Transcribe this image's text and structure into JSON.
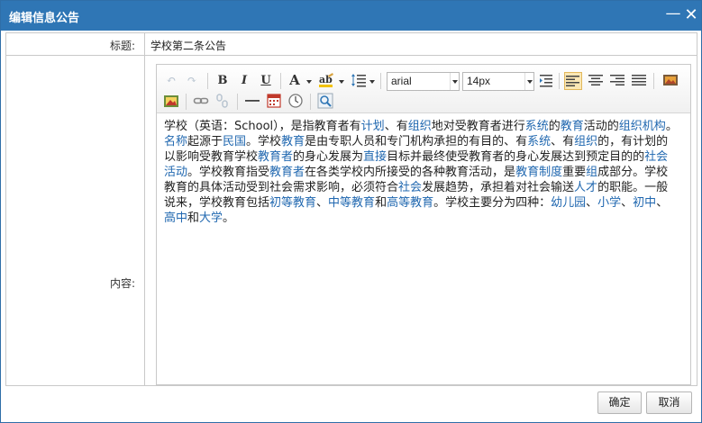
{
  "dialog": {
    "title": "编辑信息公告",
    "minimize_icon": "minimize-icon",
    "close_icon": "close-icon"
  },
  "form": {
    "title_label": "标题:",
    "title_value": "学校第二条公告",
    "content_label": "内容:"
  },
  "editor": {
    "toolbar": {
      "font_family": "arial",
      "font_size": "14px",
      "icons": [
        "undo-icon",
        "redo-icon",
        "bold-icon",
        "italic-icon",
        "underline-icon",
        "font-color-icon",
        "highlight-icon",
        "line-height-icon",
        "font-family-select",
        "font-size-select",
        "indent-icon",
        "align-left-icon",
        "align-center-icon",
        "align-right-icon",
        "justify-icon",
        "image-icon",
        "insert-image-icon",
        "link-icon",
        "unlink-icon",
        "horizontal-rule-icon",
        "date-icon",
        "time-icon",
        "preview-icon"
      ],
      "bold": "B",
      "italic": "I",
      "underline": "U",
      "font_color": "A"
    },
    "content": [
      {
        "t": "学校（英语：School），是指教育者有"
      },
      {
        "t": "计划",
        "link": true
      },
      {
        "t": "、有"
      },
      {
        "t": "组织",
        "link": true
      },
      {
        "t": "地对受教育者进行"
      },
      {
        "t": "系统",
        "link": true
      },
      {
        "t": "的"
      },
      {
        "t": "教育",
        "link": true
      },
      {
        "t": "活动的"
      },
      {
        "t": "组织机构",
        "link": true
      },
      {
        "t": "。"
      },
      {
        "t": "名称",
        "link": true
      },
      {
        "t": "起源于"
      },
      {
        "t": "民国",
        "link": true
      },
      {
        "t": "。学校"
      },
      {
        "t": "教育",
        "link": true
      },
      {
        "t": "是由专职人员和专门机构承担的有目的、有"
      },
      {
        "t": "系统",
        "link": true
      },
      {
        "t": "、有"
      },
      {
        "t": "组织",
        "link": true
      },
      {
        "t": "的，有计划的以影响受教育学校"
      },
      {
        "t": "教育者",
        "link": true
      },
      {
        "t": "的身心发展为"
      },
      {
        "t": "直接",
        "link": true
      },
      {
        "t": "目标并最终使受教育者的身心发展达到预定目的的"
      },
      {
        "t": "社会活动",
        "link": true
      },
      {
        "t": "。学校教育指受"
      },
      {
        "t": "教育者",
        "link": true
      },
      {
        "t": "在各类学校内所接受的各种教育活动，是"
      },
      {
        "t": "教育制度",
        "link": true
      },
      {
        "t": "重要"
      },
      {
        "t": "组",
        "link": true
      },
      {
        "t": "成部分。学校教育的具体活动受到社会需求影响，必须符合"
      },
      {
        "t": "社会",
        "link": true
      },
      {
        "t": "发展趋势，承担着对社会输送"
      },
      {
        "t": "人才",
        "link": true
      },
      {
        "t": "的职能。一般说来，学校教育包括"
      },
      {
        "t": "初等教育",
        "link": true
      },
      {
        "t": "、"
      },
      {
        "t": "中等教育",
        "link": true
      },
      {
        "t": "和"
      },
      {
        "t": "高等教育",
        "link": true
      },
      {
        "t": "。学校主要分为四种："
      },
      {
        "t": "幼儿园",
        "link": true
      },
      {
        "t": "、"
      },
      {
        "t": "小学",
        "link": true
      },
      {
        "t": "、"
      },
      {
        "t": "初中",
        "link": true
      },
      {
        "t": "、"
      },
      {
        "t": "高中",
        "link": true
      },
      {
        "t": "和"
      },
      {
        "t": "大学",
        "link": true
      },
      {
        "t": "。"
      }
    ]
  },
  "buttons": {
    "ok": "确定",
    "cancel": "取消"
  },
  "colors": {
    "titlebar": "#2f76b5",
    "link": "#2168b0"
  }
}
